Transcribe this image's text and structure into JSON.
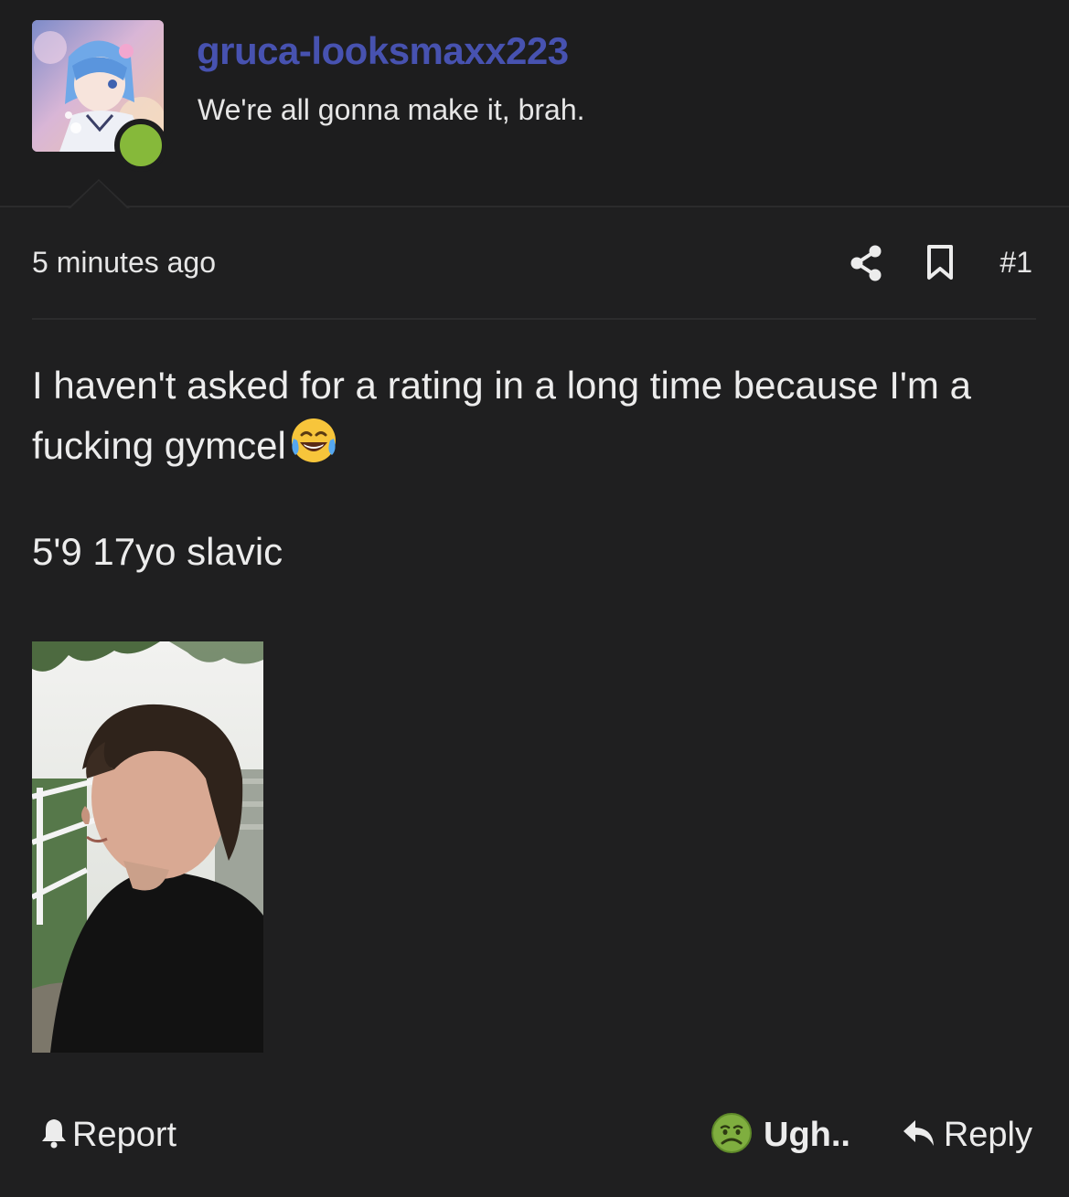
{
  "user": {
    "name": "gruca-looksmaxx223",
    "title": "We're all gonna make it, brah.",
    "online_color": "#86b93a",
    "name_color": "#4752b0"
  },
  "post": {
    "timestamp": "5 minutes ago",
    "number": "#1",
    "body_line": "I haven't asked for a rating in a long time because I'm a fucking gymcel",
    "body_emoji": "tears-of-joy-emoji",
    "stats": "5'9 17yo slavic",
    "attachment_icon": "photo-attachment"
  },
  "footer": {
    "report_label": "Report",
    "reaction_label": "Ugh..",
    "reaction_icon": "nauseated-face-icon",
    "reply_label": "Reply"
  }
}
